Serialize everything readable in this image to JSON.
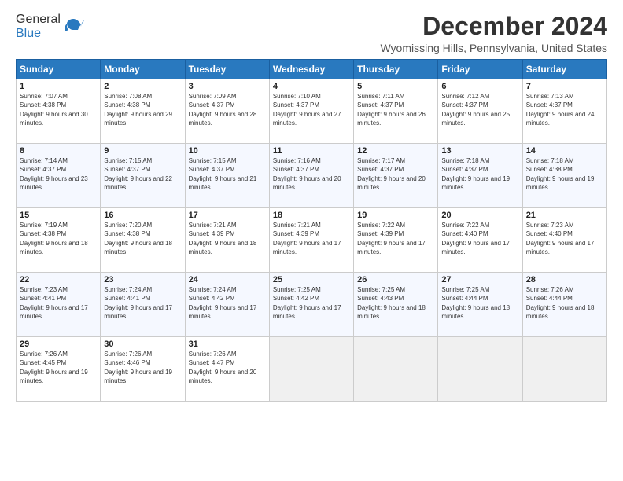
{
  "header": {
    "logo_general": "General",
    "logo_blue": "Blue",
    "month": "December 2024",
    "location": "Wyomissing Hills, Pennsylvania, United States"
  },
  "weekdays": [
    "Sunday",
    "Monday",
    "Tuesday",
    "Wednesday",
    "Thursday",
    "Friday",
    "Saturday"
  ],
  "weeks": [
    [
      {
        "day": "1",
        "sunrise": "Sunrise: 7:07 AM",
        "sunset": "Sunset: 4:38 PM",
        "daylight": "Daylight: 9 hours and 30 minutes."
      },
      {
        "day": "2",
        "sunrise": "Sunrise: 7:08 AM",
        "sunset": "Sunset: 4:38 PM",
        "daylight": "Daylight: 9 hours and 29 minutes."
      },
      {
        "day": "3",
        "sunrise": "Sunrise: 7:09 AM",
        "sunset": "Sunset: 4:37 PM",
        "daylight": "Daylight: 9 hours and 28 minutes."
      },
      {
        "day": "4",
        "sunrise": "Sunrise: 7:10 AM",
        "sunset": "Sunset: 4:37 PM",
        "daylight": "Daylight: 9 hours and 27 minutes."
      },
      {
        "day": "5",
        "sunrise": "Sunrise: 7:11 AM",
        "sunset": "Sunset: 4:37 PM",
        "daylight": "Daylight: 9 hours and 26 minutes."
      },
      {
        "day": "6",
        "sunrise": "Sunrise: 7:12 AM",
        "sunset": "Sunset: 4:37 PM",
        "daylight": "Daylight: 9 hours and 25 minutes."
      },
      {
        "day": "7",
        "sunrise": "Sunrise: 7:13 AM",
        "sunset": "Sunset: 4:37 PM",
        "daylight": "Daylight: 9 hours and 24 minutes."
      }
    ],
    [
      {
        "day": "8",
        "sunrise": "Sunrise: 7:14 AM",
        "sunset": "Sunset: 4:37 PM",
        "daylight": "Daylight: 9 hours and 23 minutes."
      },
      {
        "day": "9",
        "sunrise": "Sunrise: 7:15 AM",
        "sunset": "Sunset: 4:37 PM",
        "daylight": "Daylight: 9 hours and 22 minutes."
      },
      {
        "day": "10",
        "sunrise": "Sunrise: 7:15 AM",
        "sunset": "Sunset: 4:37 PM",
        "daylight": "Daylight: 9 hours and 21 minutes."
      },
      {
        "day": "11",
        "sunrise": "Sunrise: 7:16 AM",
        "sunset": "Sunset: 4:37 PM",
        "daylight": "Daylight: 9 hours and 20 minutes."
      },
      {
        "day": "12",
        "sunrise": "Sunrise: 7:17 AM",
        "sunset": "Sunset: 4:37 PM",
        "daylight": "Daylight: 9 hours and 20 minutes."
      },
      {
        "day": "13",
        "sunrise": "Sunrise: 7:18 AM",
        "sunset": "Sunset: 4:37 PM",
        "daylight": "Daylight: 9 hours and 19 minutes."
      },
      {
        "day": "14",
        "sunrise": "Sunrise: 7:18 AM",
        "sunset": "Sunset: 4:38 PM",
        "daylight": "Daylight: 9 hours and 19 minutes."
      }
    ],
    [
      {
        "day": "15",
        "sunrise": "Sunrise: 7:19 AM",
        "sunset": "Sunset: 4:38 PM",
        "daylight": "Daylight: 9 hours and 18 minutes."
      },
      {
        "day": "16",
        "sunrise": "Sunrise: 7:20 AM",
        "sunset": "Sunset: 4:38 PM",
        "daylight": "Daylight: 9 hours and 18 minutes."
      },
      {
        "day": "17",
        "sunrise": "Sunrise: 7:21 AM",
        "sunset": "Sunset: 4:39 PM",
        "daylight": "Daylight: 9 hours and 18 minutes."
      },
      {
        "day": "18",
        "sunrise": "Sunrise: 7:21 AM",
        "sunset": "Sunset: 4:39 PM",
        "daylight": "Daylight: 9 hours and 17 minutes."
      },
      {
        "day": "19",
        "sunrise": "Sunrise: 7:22 AM",
        "sunset": "Sunset: 4:39 PM",
        "daylight": "Daylight: 9 hours and 17 minutes."
      },
      {
        "day": "20",
        "sunrise": "Sunrise: 7:22 AM",
        "sunset": "Sunset: 4:40 PM",
        "daylight": "Daylight: 9 hours and 17 minutes."
      },
      {
        "day": "21",
        "sunrise": "Sunrise: 7:23 AM",
        "sunset": "Sunset: 4:40 PM",
        "daylight": "Daylight: 9 hours and 17 minutes."
      }
    ],
    [
      {
        "day": "22",
        "sunrise": "Sunrise: 7:23 AM",
        "sunset": "Sunset: 4:41 PM",
        "daylight": "Daylight: 9 hours and 17 minutes."
      },
      {
        "day": "23",
        "sunrise": "Sunrise: 7:24 AM",
        "sunset": "Sunset: 4:41 PM",
        "daylight": "Daylight: 9 hours and 17 minutes."
      },
      {
        "day": "24",
        "sunrise": "Sunrise: 7:24 AM",
        "sunset": "Sunset: 4:42 PM",
        "daylight": "Daylight: 9 hours and 17 minutes."
      },
      {
        "day": "25",
        "sunrise": "Sunrise: 7:25 AM",
        "sunset": "Sunset: 4:42 PM",
        "daylight": "Daylight: 9 hours and 17 minutes."
      },
      {
        "day": "26",
        "sunrise": "Sunrise: 7:25 AM",
        "sunset": "Sunset: 4:43 PM",
        "daylight": "Daylight: 9 hours and 18 minutes."
      },
      {
        "day": "27",
        "sunrise": "Sunrise: 7:25 AM",
        "sunset": "Sunset: 4:44 PM",
        "daylight": "Daylight: 9 hours and 18 minutes."
      },
      {
        "day": "28",
        "sunrise": "Sunrise: 7:26 AM",
        "sunset": "Sunset: 4:44 PM",
        "daylight": "Daylight: 9 hours and 18 minutes."
      }
    ],
    [
      {
        "day": "29",
        "sunrise": "Sunrise: 7:26 AM",
        "sunset": "Sunset: 4:45 PM",
        "daylight": "Daylight: 9 hours and 19 minutes."
      },
      {
        "day": "30",
        "sunrise": "Sunrise: 7:26 AM",
        "sunset": "Sunset: 4:46 PM",
        "daylight": "Daylight: 9 hours and 19 minutes."
      },
      {
        "day": "31",
        "sunrise": "Sunrise: 7:26 AM",
        "sunset": "Sunset: 4:47 PM",
        "daylight": "Daylight: 9 hours and 20 minutes."
      },
      null,
      null,
      null,
      null
    ]
  ]
}
